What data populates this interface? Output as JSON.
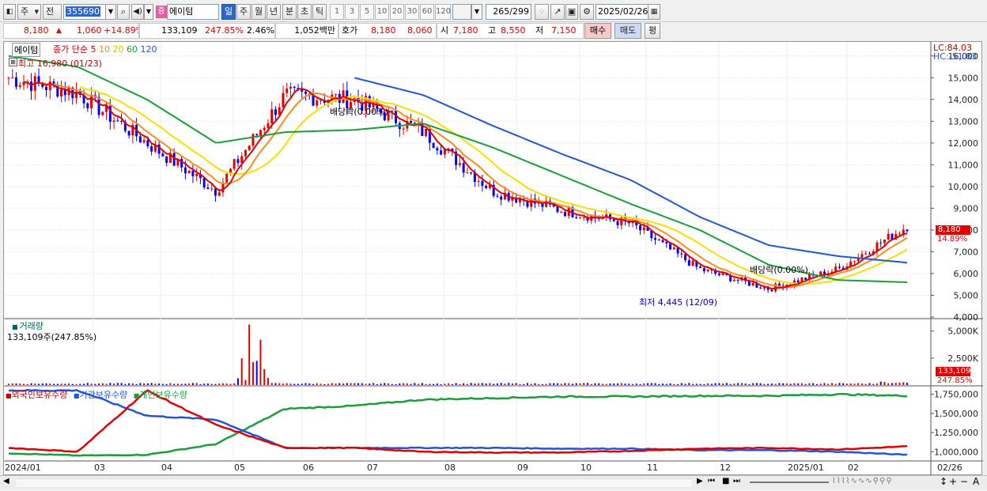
{
  "toolbar": {
    "type_label": "주",
    "jeon_label": "전",
    "code": "355690",
    "badge": "증",
    "name": "에이텀",
    "periods": [
      "일",
      "주",
      "월",
      "년",
      "분",
      "초",
      "틱"
    ],
    "minutes": [
      "1",
      "3",
      "5",
      "10",
      "20",
      "30",
      "60",
      "120"
    ],
    "count": "265",
    "count_total": "/299",
    "date": "2025/02/26"
  },
  "info": {
    "price": "8,180",
    "change": "1,060",
    "rate": "+14.89%",
    "volume": "133,109",
    "vol_ratio": "247.85%",
    "turnover": "2.46%",
    "amount": "1,052백만",
    "hoga_label": "호가",
    "ask": "8,180",
    "bid": "8,060",
    "open_label": "시",
    "open": "7,180",
    "high_label": "고",
    "high": "8,550",
    "low_label": "저",
    "low": "7,150",
    "buy": "매수",
    "sell": "매도",
    "eval": "평"
  },
  "price_panel": {
    "name": "에이텀",
    "indicator": "종가 단순",
    "ma_labels": [
      "5",
      "10",
      "20",
      "60",
      "120"
    ],
    "max_text": "최고 16,980 (01/23)",
    "min_text": "최저 4,445 (12/09)",
    "div1": "배당락(0.00%)",
    "div2": "배당락(0.00%)",
    "lc": "LC:84.03",
    "hc": "HC:-51.83",
    "y_ticks": [
      "16,000",
      "15,000",
      "14,000",
      "13,000",
      "12,000",
      "11,000",
      "10,000",
      "9,000",
      "8,000",
      "7,000",
      "6,000",
      "5,000",
      "4,000"
    ],
    "last_price": "8,180",
    "last_rate": "14.89%"
  },
  "volume_panel": {
    "title": "거래량",
    "value": "133,109주(247.85%)",
    "y_ticks": [
      "5,000K",
      "2,500K"
    ],
    "last": "133,109",
    "last_rate": "247.85%"
  },
  "holding_panel": {
    "legend": [
      "외국인보유수량",
      "기관보유수량",
      "개인보유수량"
    ],
    "y_ticks": [
      "1,750,000",
      "1,500,000",
      "1,250,000",
      "1,000,000"
    ]
  },
  "x_ticks": [
    "2024/01",
    "03",
    "04",
    "05",
    "06",
    "07",
    "08",
    "09",
    "10",
    "11",
    "12",
    "2025/01",
    "02"
  ],
  "x_right": "02/26",
  "colors": {
    "up": "#e00000",
    "down": "#0000ff",
    "ma5": "#e00000",
    "ma10": "#ff8c1a",
    "ma20": "#f5e000",
    "ma60": "#1a9e3a",
    "ma120": "#2255dd"
  },
  "chart_data": {
    "type": "candlestick",
    "x": [
      "2024-01",
      "2024-02",
      "2024-03",
      "2024-04",
      "2024-05",
      "2024-06",
      "2024-07",
      "2024-08",
      "2024-09",
      "2024-10",
      "2024-11",
      "2024-12",
      "2025-01",
      "2025-02"
    ],
    "close": [
      15000,
      14300,
      12000,
      9800,
      14200,
      14000,
      12500,
      9800,
      8900,
      8300,
      6200,
      5300,
      6200,
      8180
    ],
    "ma120": [
      null,
      null,
      null,
      null,
      null,
      15000,
      14200,
      12800,
      11500,
      10300,
      8600,
      7300,
      6800,
      6500
    ],
    "ma60": [
      16000,
      15500,
      14000,
      12000,
      12500,
      12600,
      12900,
      11800,
      10500,
      9200,
      8000,
      6400,
      5700,
      5600
    ],
    "price_range": [
      4000,
      16500
    ],
    "volume_range": [
      0,
      6000000
    ],
    "holding_range": [
      900000,
      1850000
    ],
    "foreign": [
      1050000,
      1000000,
      1800000,
      1350000,
      1050000,
      1050000,
      1000000,
      990000,
      990000,
      1010000,
      1040000,
      1050000,
      1030000,
      1070000
    ],
    "institution": [
      1800000,
      1800000,
      1470000,
      1420000,
      1050000,
      1050000,
      1050000,
      1050000,
      1040000,
      1040000,
      1020000,
      1020000,
      1000000,
      960000
    ],
    "individual": [
      980000,
      950000,
      960000,
      1100000,
      1560000,
      1600000,
      1680000,
      1700000,
      1720000,
      1720000,
      1730000,
      1730000,
      1750000,
      1730000
    ]
  }
}
